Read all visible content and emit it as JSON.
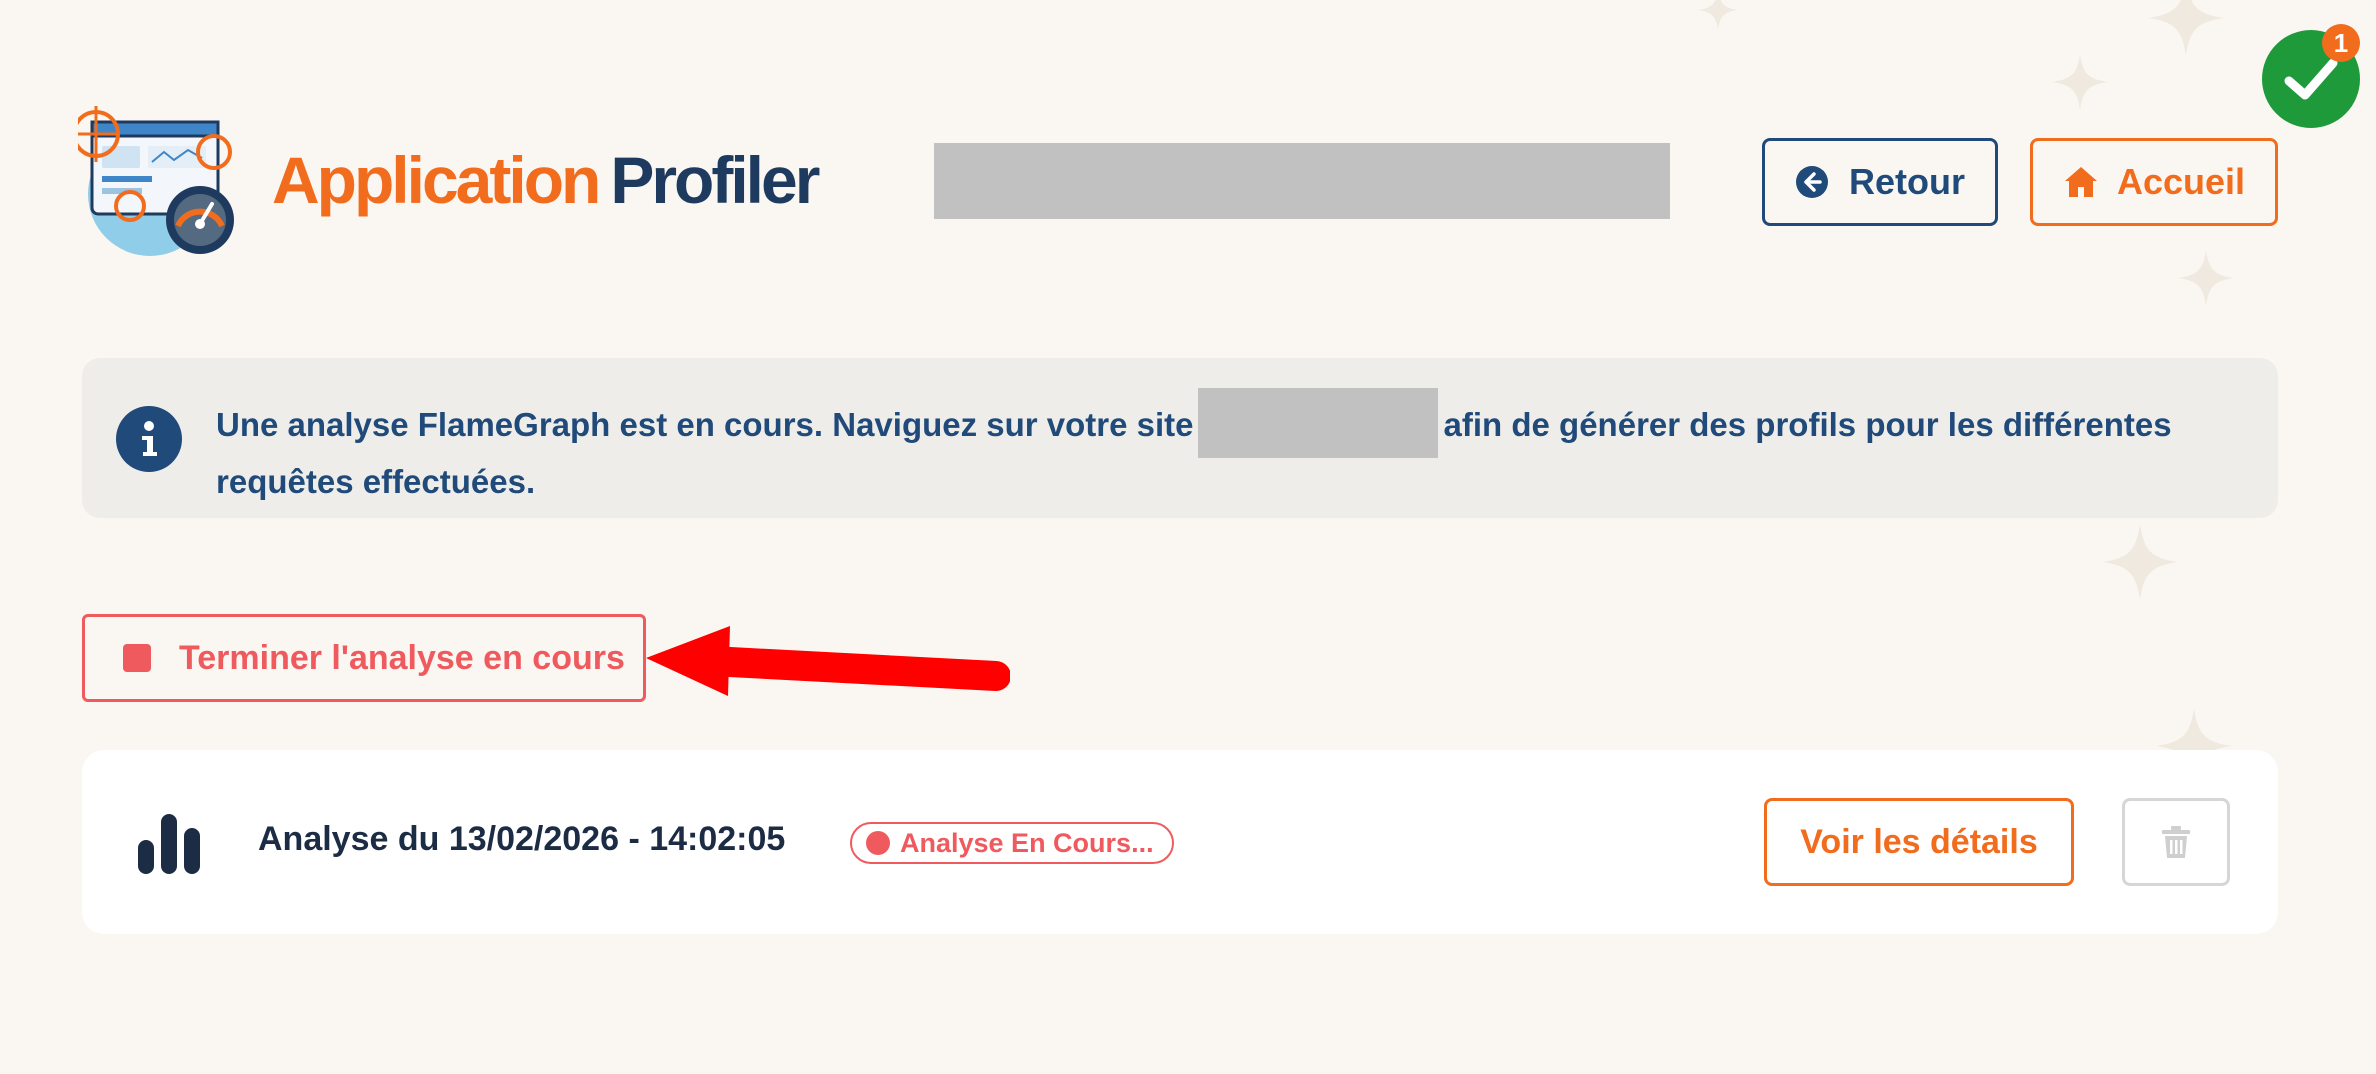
{
  "header": {
    "title_part1": "Application",
    "title_part2": "Profiler",
    "back_label": "Retour",
    "home_label": "Accueil",
    "notification_count": "1"
  },
  "info": {
    "text_before": "Une analyse FlameGraph est en cours. Naviguez sur votre site",
    "text_after": "afin de générer des profils pour les différentes requêtes effectuées."
  },
  "actions": {
    "stop_label": "Terminer l'analyse en cours"
  },
  "analyses": [
    {
      "title": "Analyse du 13/02/2026 - 14:02:05",
      "status": "Analyse En Cours...",
      "details_label": "Voir les détails"
    }
  ],
  "icons": {
    "logo": "app-profiler-logo",
    "back": "arrow-left-circle-icon",
    "home": "home-icon",
    "status": "check-icon",
    "info": "info-icon",
    "stop": "stop-icon",
    "analysis": "bar-chart-icon",
    "delete": "trash-icon"
  },
  "colors": {
    "brand_orange": "#f26c1d",
    "brand_navy": "#1f3a5f",
    "danger": "#ef5a5e",
    "success": "#1e9a3a",
    "background": "#faf7f2"
  }
}
